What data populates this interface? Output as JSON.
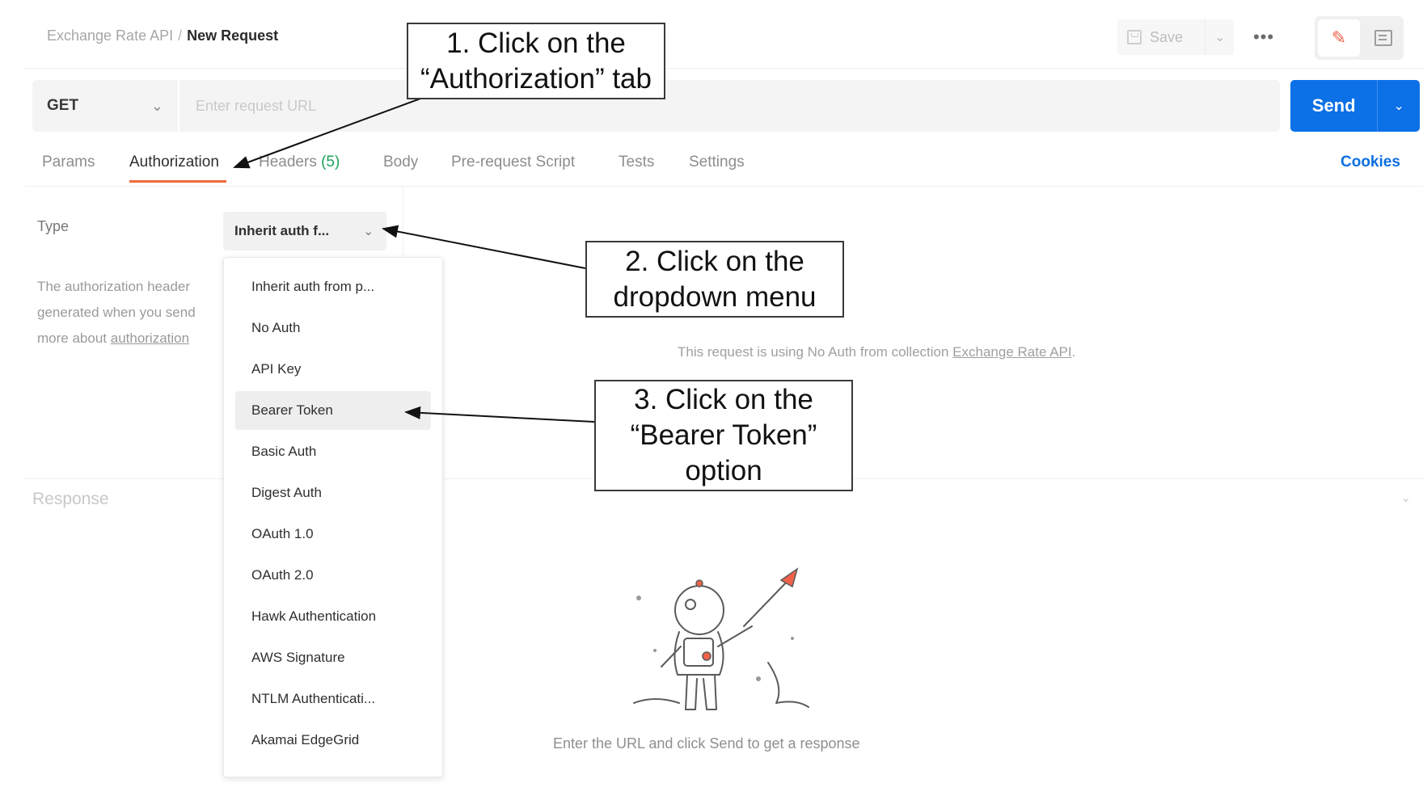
{
  "header": {
    "breadcrumb_collection": "Exchange Rate API",
    "breadcrumb_separator": "/",
    "breadcrumb_current": "New Request",
    "save_label": "Save",
    "more_label": "•••"
  },
  "request": {
    "method": "GET",
    "url_placeholder": "Enter request URL",
    "send_label": "Send"
  },
  "tabs": {
    "params": "Params",
    "authorization": "Authorization",
    "headers": "Headers",
    "headers_count": "(5)",
    "body": "Body",
    "prerequest": "Pre-request Script",
    "tests": "Tests",
    "settings": "Settings",
    "cookies": "Cookies",
    "active": "Authorization"
  },
  "auth": {
    "type_label": "Type",
    "selected_value": "Inherit auth f...",
    "description_line_1": "The authorization header",
    "description_line_2": "generated when you send",
    "description_line_3_prefix": "more about ",
    "description_line_3_link": "authorization",
    "noauth_text": "This request is using No Auth from collection ",
    "noauth_link": "Exchange Rate API",
    "noauth_suffix": ".",
    "menu_items": [
      "Inherit auth from p...",
      "No Auth",
      "API Key",
      "Bearer Token",
      "Basic Auth",
      "Digest Auth",
      "OAuth 1.0",
      "OAuth 2.0",
      "Hawk Authentication",
      "AWS Signature",
      "NTLM Authenticati...",
      "Akamai EdgeGrid"
    ],
    "highlighted_item": "Bearer Token"
  },
  "response": {
    "label": "Response",
    "empty_text": "Enter the URL and click Send to get a response"
  },
  "annotations": {
    "step1_line1": "1.  Click on the",
    "step1_line2": "“Authorization” tab",
    "step2_line1": "2.  Click on the",
    "step2_line2": "dropdown menu",
    "step3_line1": "3.  Click on the",
    "step3_line2": "“Bearer Token”",
    "step3_line3": "option"
  },
  "colors": {
    "accent_send": "#0c70e6",
    "tab_underline": "#f26b3a",
    "headers_count": "#19a35a",
    "cookies_link": "#0b6fe2"
  },
  "icons": {
    "save": "save-icon",
    "edit": "pencil-icon",
    "documentation": "document-icon",
    "more": "more-dots-icon"
  }
}
